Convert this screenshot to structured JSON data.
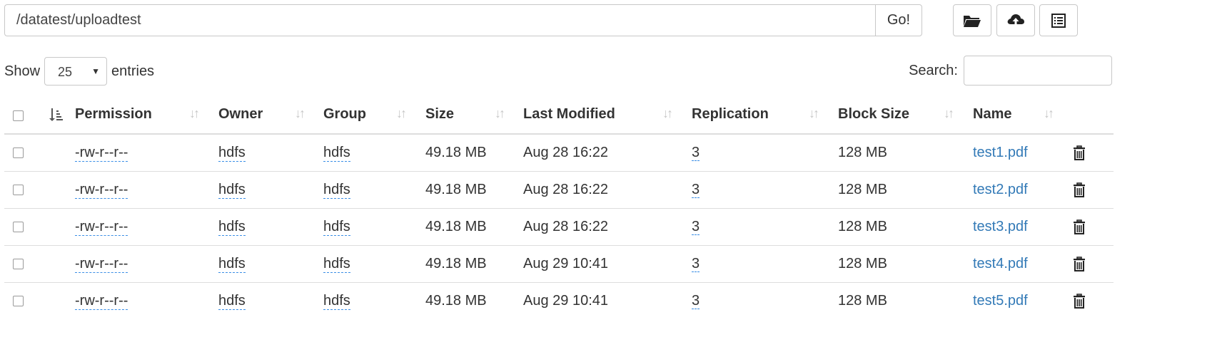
{
  "path_bar": {
    "path_value": "/datatest/uploadtest",
    "go_label": "Go!"
  },
  "toolbar": {
    "icons": [
      "folder-open-icon",
      "cloud-upload-icon",
      "list-alt-icon"
    ]
  },
  "length_control": {
    "show_label": "Show",
    "selected": "25",
    "entries_label": "entries"
  },
  "search": {
    "label": "Search:",
    "value": ""
  },
  "table": {
    "headers": {
      "permission": "Permission",
      "owner": "Owner",
      "group": "Group",
      "size": "Size",
      "last_modified": "Last Modified",
      "replication": "Replication",
      "block_size": "Block Size",
      "name": "Name"
    },
    "rows": [
      {
        "permission": "-rw-r--r--",
        "owner": "hdfs",
        "group": "hdfs",
        "size": "49.18 MB",
        "last_modified": "Aug 28 16:22",
        "replication": "3",
        "block_size": "128 MB",
        "name": "test1.pdf"
      },
      {
        "permission": "-rw-r--r--",
        "owner": "hdfs",
        "group": "hdfs",
        "size": "49.18 MB",
        "last_modified": "Aug 28 16:22",
        "replication": "3",
        "block_size": "128 MB",
        "name": "test2.pdf"
      },
      {
        "permission": "-rw-r--r--",
        "owner": "hdfs",
        "group": "hdfs",
        "size": "49.18 MB",
        "last_modified": "Aug 28 16:22",
        "replication": "3",
        "block_size": "128 MB",
        "name": "test3.pdf"
      },
      {
        "permission": "-rw-r--r--",
        "owner": "hdfs",
        "group": "hdfs",
        "size": "49.18 MB",
        "last_modified": "Aug 29 10:41",
        "replication": "3",
        "block_size": "128 MB",
        "name": "test4.pdf"
      },
      {
        "permission": "-rw-r--r--",
        "owner": "hdfs",
        "group": "hdfs",
        "size": "49.18 MB",
        "last_modified": "Aug 29 10:41",
        "replication": "3",
        "block_size": "128 MB",
        "name": "test5.pdf"
      }
    ]
  },
  "colors": {
    "link": "#337ab7",
    "dashed_underline": "#3a8ee6",
    "border": "#dddddd"
  }
}
